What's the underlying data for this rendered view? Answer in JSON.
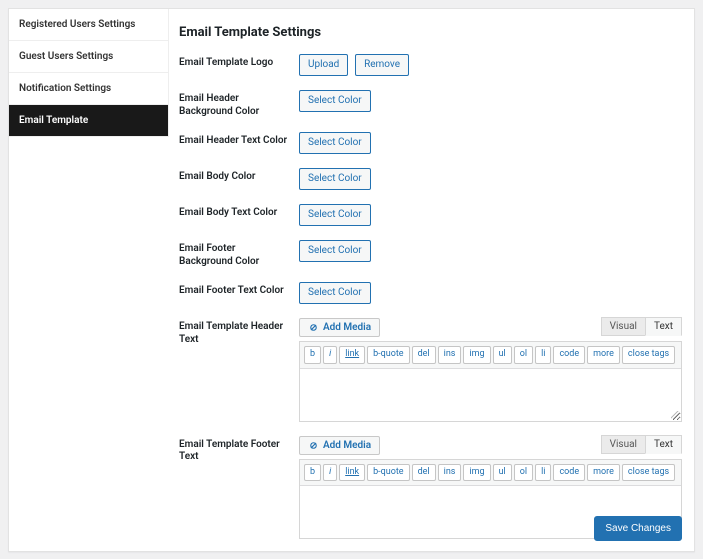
{
  "sidebar": {
    "items": [
      {
        "label": "Registered Users Settings",
        "active": false
      },
      {
        "label": "Guest Users Settings",
        "active": false
      },
      {
        "label": "Notification Settings",
        "active": false
      },
      {
        "label": "Email Template",
        "active": true
      }
    ]
  },
  "page": {
    "heading": "Email Template Settings",
    "save_button": "Save Changes"
  },
  "fields": {
    "logo": {
      "label": "Email Template Logo",
      "upload_btn": "Upload",
      "remove_btn": "Remove"
    },
    "header_bg_color": {
      "label": "Email Header Background Color",
      "btn": "Select Color"
    },
    "header_text_color": {
      "label": "Email Header Text Color",
      "btn": "Select Color"
    },
    "body_color": {
      "label": "Email Body Color",
      "btn": "Select Color"
    },
    "body_text_color": {
      "label": "Email Body Text Color",
      "btn": "Select Color"
    },
    "footer_bg_color": {
      "label": "Email Footer Background Color",
      "btn": "Select Color"
    },
    "footer_text_color": {
      "label": "Email Footer Text Color",
      "btn": "Select Color"
    },
    "header_text": {
      "label": "Email Template Header Text"
    },
    "footer_text": {
      "label": "Email Template Footer Text"
    }
  },
  "editor": {
    "add_media": "Add Media",
    "tabs": {
      "visual": "Visual",
      "text": "Text"
    },
    "quicktags": [
      "b",
      "i",
      "link",
      "b-quote",
      "del",
      "ins",
      "img",
      "ul",
      "ol",
      "li",
      "code",
      "more",
      "close tags"
    ]
  }
}
